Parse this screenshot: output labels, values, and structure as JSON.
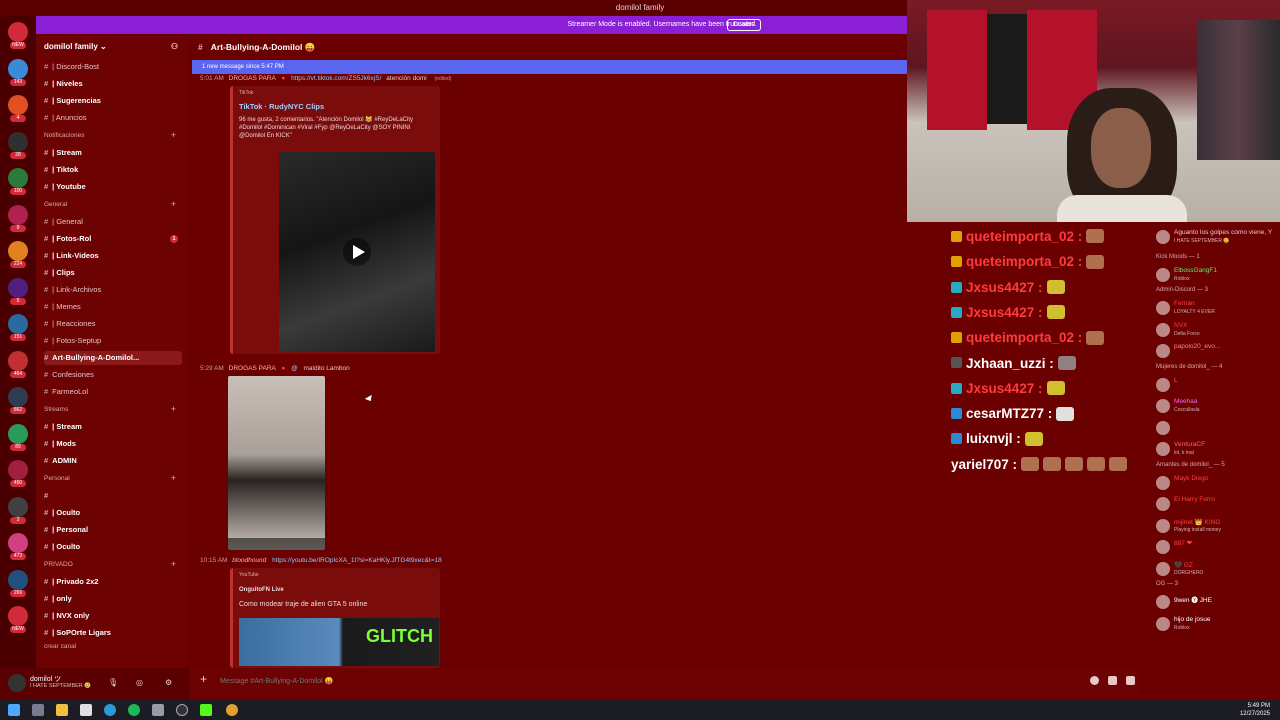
{
  "window": {
    "title": "domilol family"
  },
  "banner": {
    "text": "Streamer Mode is enabled. Usernames have been truncated.",
    "disable_label": "Disable"
  },
  "server": {
    "name": "domilol family ⌄"
  },
  "server_rail": {
    "badges": [
      "NEW",
      "143",
      "4",
      "28",
      "100",
      "9",
      "224",
      "5",
      "151",
      "464",
      "862",
      "89",
      "450",
      "3",
      "473",
      "269",
      "NEW"
    ]
  },
  "channels": {
    "top": [
      {
        "label": "| Discord-Bost",
        "bold": false
      },
      {
        "label": "| Niveles",
        "bold": true
      },
      {
        "label": "| Sugerencias",
        "bold": true
      },
      {
        "label": "| Anuncios",
        "bold": false
      }
    ],
    "cat_notificaciones": "Notificaciones",
    "notificaciones": [
      "| Stream",
      "| Tiktok",
      "| Youtube"
    ],
    "cat_general": "General",
    "general": [
      {
        "label": "| General",
        "bold": false
      },
      {
        "label": "| Fotos-Rol",
        "bold": true,
        "badge": "1"
      },
      {
        "label": "| Link-Videos",
        "bold": true
      },
      {
        "label": "| Clips",
        "bold": true
      },
      {
        "label": "| Link-Archivos",
        "bold": false
      },
      {
        "label": "| Memes",
        "bold": false
      },
      {
        "label": "| Reacciones",
        "bold": false
      },
      {
        "label": "| Fotos-Septup",
        "bold": false
      },
      {
        "label": "Art-Bullying-A-Domilol...",
        "bold": true,
        "active": true
      },
      {
        "label": "Confesiones",
        "bold": false
      },
      {
        "label": "FarmeoLol",
        "bold": false
      }
    ],
    "cat_streams": "Streams",
    "streams": [
      "| Stream",
      "| Mods",
      "ADMIN"
    ],
    "cat_personal": "Personal",
    "personal": [
      "",
      "| Oculto",
      "| Personal",
      "| Oculto"
    ],
    "cat_privado": "PRIVADO",
    "privado": [
      "| Privado 2x2",
      "| only",
      "| NVX only",
      "| SoPOrte Ligars"
    ],
    "cat_crear": "crear canal"
  },
  "chat": {
    "channel_name": "Art-Bullying-A-Domilol 😛",
    "new_messages": "1 new message since 5:47 PM",
    "msg1": {
      "time": "5:01 AM",
      "author": "DROGAS PARA",
      "link": "https://vt.tiktok.com/ZS5Jk6xjS/",
      "text": "atención domi",
      "edited": "(edited)"
    },
    "embed1": {
      "provider": "TikTok",
      "title": "TikTok · RudyNYC Clips",
      "desc": "96 me gusta, 2 comentarios. \"Atención Domilol 😹 #ReyDeLaCity #Domilol #Dominican #Viral #Fyp @ReyDeLaCity @SOY PININI @Domilol En KICK\""
    },
    "msg2": {
      "time": "5:29 AM",
      "author": "DROGAS PARA",
      "text": "maldito Lambon"
    },
    "msg3": {
      "time": "10:15 AM",
      "author": "bloodhound",
      "link": "https://youtu.be/IROpIcXA_1I?si=KaHKly.JfTG4t9xec&t=18"
    },
    "embed3": {
      "provider": "YouTube",
      "channel": "OnguitoFN Live",
      "title": "Como modear traje de alien GTA 5 online",
      "thumb_text": "GLITCH"
    },
    "composer_placeholder": "Message #Art-Bullying-A-Domilol 😛"
  },
  "user_panel": {
    "name": "domilol ツ",
    "status": "I HATE SEPTEMBER 😢"
  },
  "stream_chat": [
    {
      "name": "queteimporta_02 :",
      "color": "#ff3b3b",
      "badge": "#e0a000"
    },
    {
      "name": "queteimporta_02 :",
      "color": "#ff3b3b",
      "badge": "#e0a000"
    },
    {
      "name": "Jxsus4427 :",
      "color": "#ff3b3b",
      "badge": "#2aa8c8"
    },
    {
      "name": "Jxsus4427 :",
      "color": "#ff3b3b",
      "badge": "#2aa8c8"
    },
    {
      "name": "queteimporta_02 :",
      "color": "#ff3b3b",
      "badge": "#e0a000"
    },
    {
      "name": "Jxhaan_uzzi :",
      "color": "#ffffff",
      "badge": "#555555"
    },
    {
      "name": "Jxsus4427 :",
      "color": "#ff3b3b",
      "badge": "#2aa8c8"
    },
    {
      "name": "cesarMTZ77 :",
      "color": "#ffffff",
      "badge": "#2a8ad8"
    },
    {
      "name": "luixnvjl :",
      "color": "#ffffff",
      "badge": "#2a8ad8"
    },
    {
      "name": "yariel707 :",
      "color": "#ffffff",
      "badge": ""
    }
  ],
  "members": {
    "top_status": "Aguanto los golpes como viene, Y",
    "top_sub": "I HATE SEPTEMBER 😢",
    "cat_kick": "Kick Moods — 1",
    "kick": [
      {
        "name": "ElbossGangF1",
        "sub": "Roblox",
        "color": "#6ee06e"
      }
    ],
    "cat_admin": "Admin-Discord — 3",
    "admin": [
      {
        "name": "Fernan",
        "sub": "LOYALTY 4 EVER",
        "color": "#ff4040"
      },
      {
        "name": "NVX",
        "sub": "Delta Force",
        "color": "#ff4040"
      },
      {
        "name": "papolo20_evo...",
        "sub": "",
        "color": "#ff8080"
      }
    ],
    "cat_mujeres": "Mujeres de domilol_ — 4",
    "mujeres": [
      {
        "name": "L",
        "sub": "",
        "color": "#ff6060"
      },
      {
        "name": "Meehaa",
        "sub": "Coscullasla",
        "color": "#ff60ff"
      },
      {
        "name": "",
        "sub": "",
        "color": "#ff6060"
      },
      {
        "name": "VenturaCF",
        "sub": "lol, k mal",
        "color": "#ff6060"
      }
    ],
    "cat_amantes": "Amantes de domilol_ — 5",
    "amantes": [
      {
        "name": "Mayk Diego",
        "sub": "",
        "color": "#ff4040"
      },
      {
        "name": "El Harry Ferro",
        "sub": "",
        "color": "#ff4040"
      },
      {
        "name": "mijinet 👑 KING",
        "sub": "Playing install money",
        "color": "#ff4040"
      },
      {
        "name": "887 ❤",
        "sub": "",
        "color": "#ff4040"
      },
      {
        "name": "🖤 GZ",
        "sub": "DORGHERO",
        "color": "#ff4040"
      }
    ],
    "cat_og": "OG — 3",
    "og": [
      {
        "name": "9wen 🅨 JHE",
        "sub": "",
        "color": "#ffffff"
      },
      {
        "name": "hijo de josue",
        "sub": "Roblox",
        "color": "#ffffff"
      }
    ]
  },
  "taskbar": {
    "time": "5:49 PM",
    "date": "12/27/2025"
  }
}
